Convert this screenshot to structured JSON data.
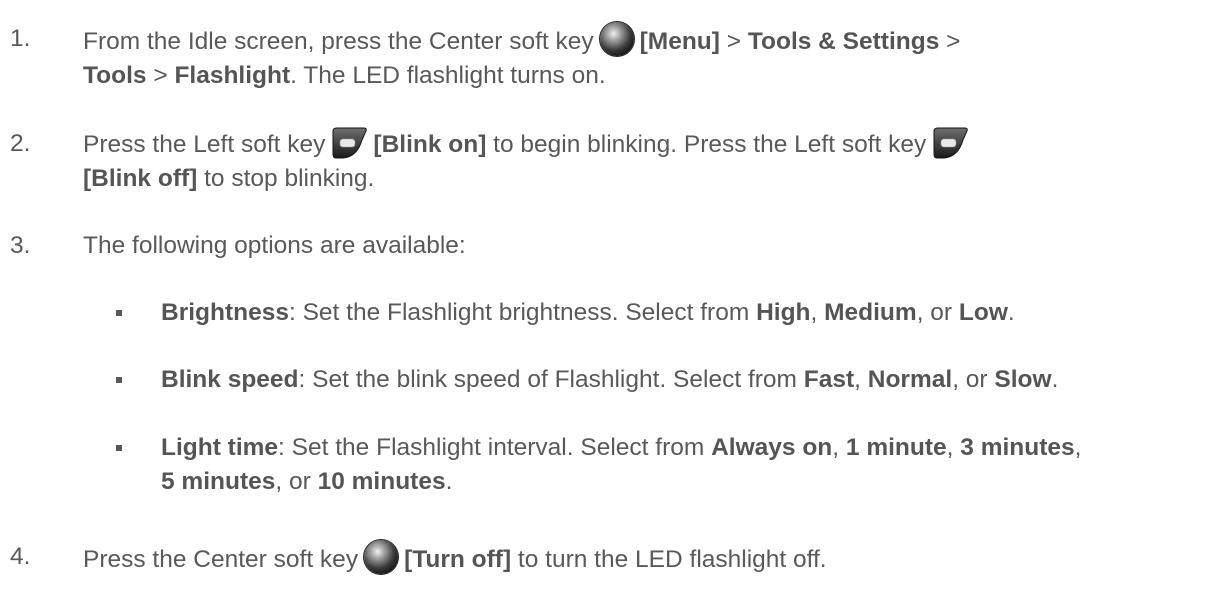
{
  "step1": {
    "num": "1.",
    "t1": "From the Idle screen, press the Center soft key",
    "k1": "[Menu]",
    "t2": " > ",
    "k2": "Tools & Settings",
    "t3": " >",
    "k3": "Tools",
    "t4": " > ",
    "k4": "Flashlight",
    "t5": ". The LED flashlight turns on."
  },
  "step2": {
    "num": "2.",
    "t1": "Press the Left soft key",
    "k1": "[Blink on]",
    "t2": " to begin blinking. Press the Left soft key",
    "k2": "[Blink off]",
    "t3": " to stop blinking."
  },
  "step3": {
    "num": "3.",
    "text": "The following options are available:"
  },
  "bullets": [
    {
      "k1": "Brightness",
      "t1": ": Set the Flashlight brightness. Select from ",
      "k2": "High",
      "t2": ", ",
      "k3": "Medium",
      "t3": ", or ",
      "k4": "Low",
      "t4": "."
    },
    {
      "k1": "Blink speed",
      "t1": ": Set the blink speed of Flashlight. Select from ",
      "k2": "Fast",
      "t2": ", ",
      "k3": "Normal",
      "t3": ", or ",
      "k4": "Slow",
      "t4": "."
    },
    {
      "k1": "Light time",
      "t1": ": Set the Flashlight interval. Select from ",
      "k2": "Always on",
      "t2": ", ",
      "k3": "1 minute",
      "t3": ", ",
      "k4": "3 minutes",
      "t4": ",",
      "k5": "5 minutes",
      "t5": ", or ",
      "k6": "10 minutes",
      "t6": "."
    }
  ],
  "step4": {
    "num": "4.",
    "t1": "Press the Center soft key",
    "k1": "[Turn off]",
    "t2": " to turn the LED flashlight off."
  },
  "icons": {
    "center": "center-soft-key-icon",
    "left": "left-soft-key-icon"
  }
}
